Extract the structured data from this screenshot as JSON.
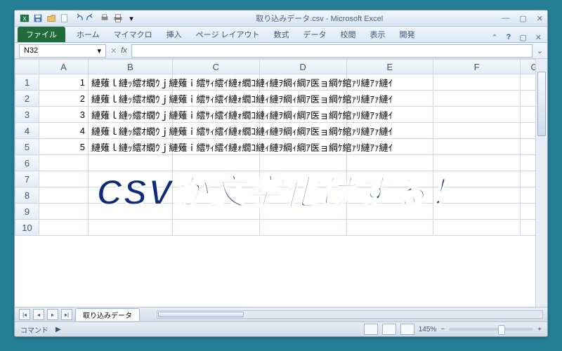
{
  "window": {
    "title": "取り込みデータ.csv - Microsoft Excel"
  },
  "ribbon": {
    "file": "ファイル",
    "tabs": [
      "ホーム",
      "マイマクロ",
      "挿入",
      "ページ レイアウト",
      "数式",
      "データ",
      "校閲",
      "表示",
      "開発"
    ]
  },
  "formulaBar": {
    "nameBox": "N32"
  },
  "grid": {
    "columns": [
      "A",
      "B",
      "C",
      "D",
      "E",
      "F",
      "G"
    ],
    "rowCount": 10,
    "rows": [
      {
        "a": 1,
        "b": "縺薙ｌ縺ｯ繧ｵ繝ｳｊ縺薙ｉ繧ｻｨ繧ｲ縺ｫ繝ｺ縺ｨ縺ｦ綱ｨ綱ｱ医ョ綱ｹ綰ｧﾘ縺ｱｧ縺ｲ"
      },
      {
        "a": 2,
        "b": "縺薙ｌ縺ｯ繧ｵ繝ｳｊ縺薙ｉ繧ｻｨ繧ｲ縺ｫ繝ｺ縺ｨ縺ｦ綱ｨ綱ｱ医ョ綱ｹ綰ｧﾘ縺ｱｧ縺ｲ"
      },
      {
        "a": 3,
        "b": "縺薙ｌ縺ｯ繧ｵ繝ｳｊ縺薙ｉ繧ｻｨ繧ｲ縺ｫ繝ｺ縺ｨ縺ｦ綱ｨ綱ｱ医ョ綱ｹ綰ｧﾘ縺ｱｧ縺ｲ"
      },
      {
        "a": 4,
        "b": "縺薙ｌ縺ｯ繧ｵ繝ｳｊ縺薙ｉ繧ｻｨ繧ｲ縺ｫ繝ｺ縺ｨ縺ｦ綱ｨ綱ｱ医ョ綱ｹ綰ｧﾘ縺ｱｧ縺ｲ"
      },
      {
        "a": 5,
        "b": "縺薙ｌ縺ｯ繧ｵ繝ｳｊ縺薙ｉ繧ｻｨ繧ｲ縺ｫ繝ｺ縺ｨ縺ｦ綱ｨ綱ｱ医ョ綱ｹ綰ｧﾘ縺ｱｧ縺ｲ"
      }
    ]
  },
  "overlay": {
    "text": "CSVが文字化けする！"
  },
  "sheets": [
    "取り込みデータ"
  ],
  "status": {
    "mode": "コマンド",
    "zoom": "145%"
  }
}
